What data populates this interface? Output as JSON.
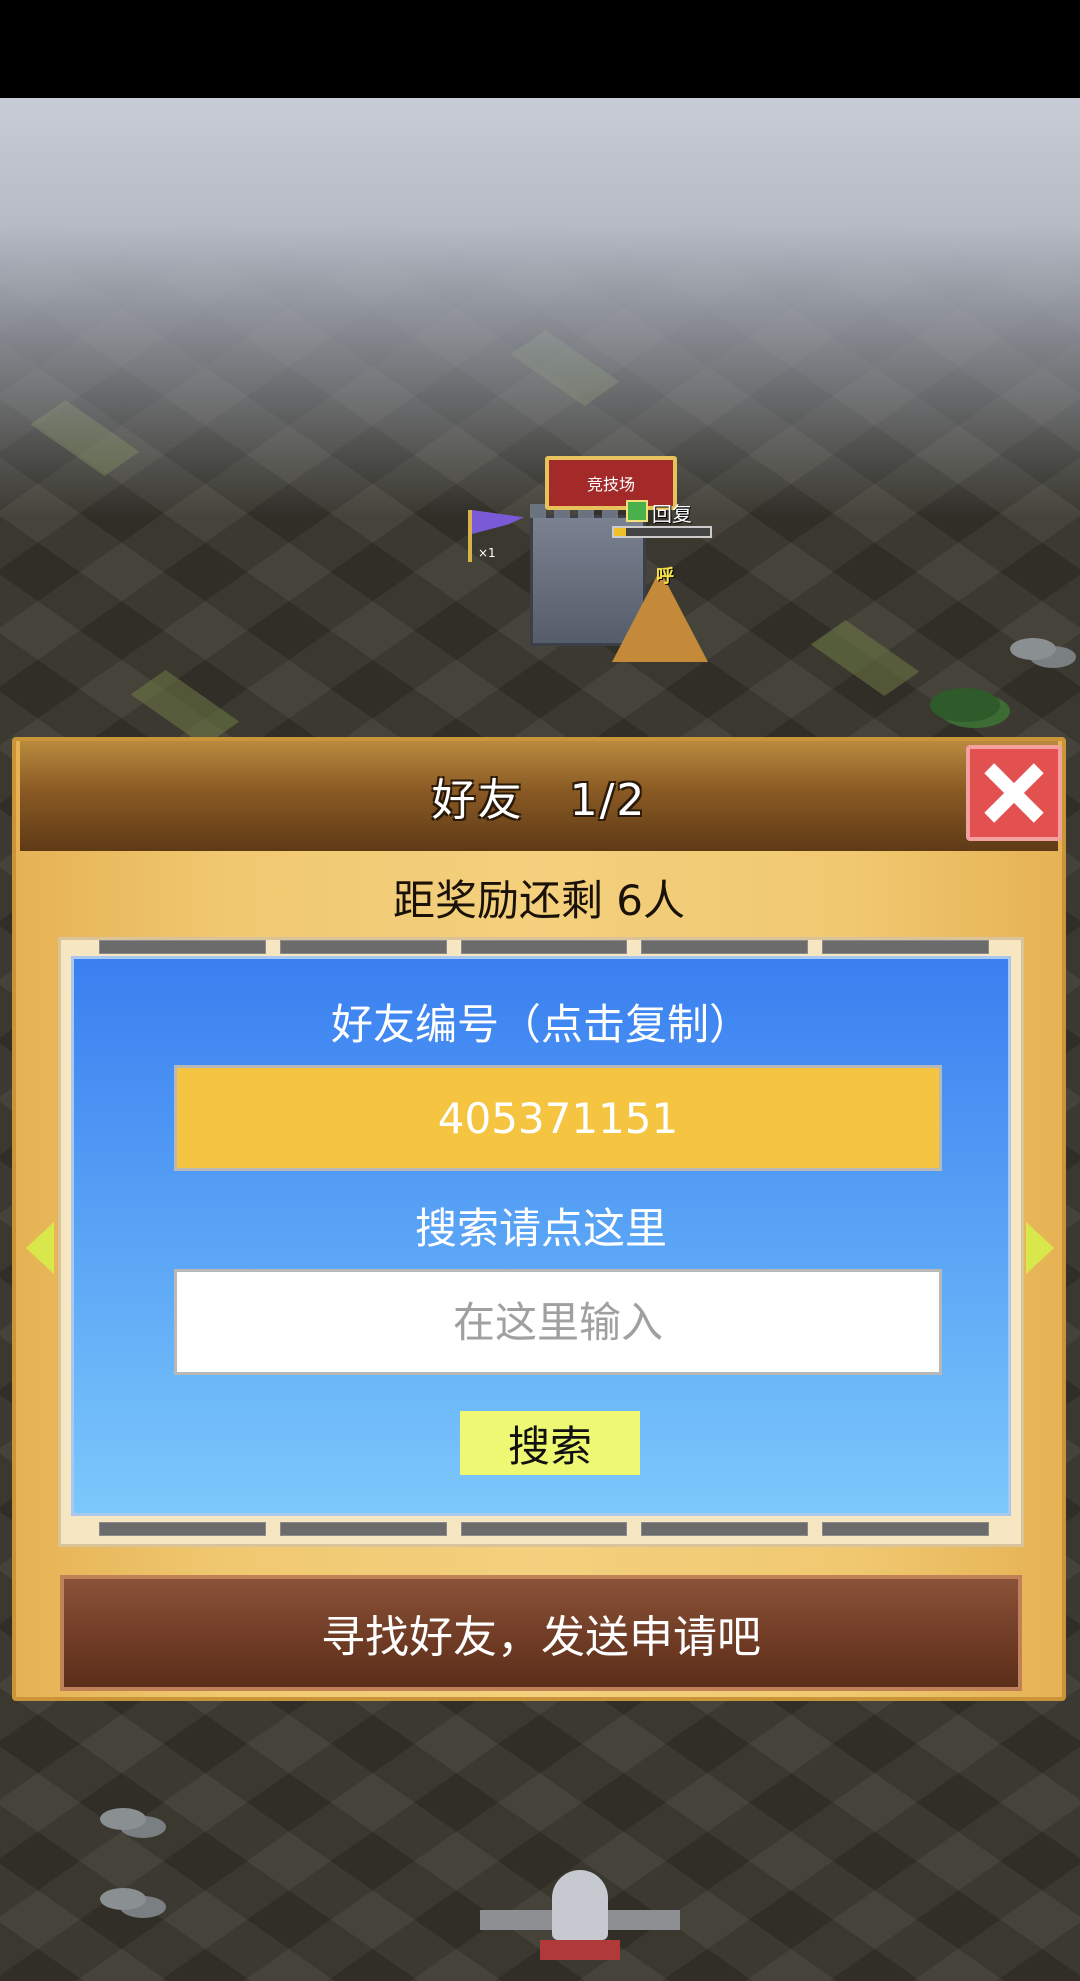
{
  "map": {
    "arena_label": "竞技场",
    "flag_count": "×1",
    "reply_label": "回复",
    "progress_fraction": 0.12,
    "shout_label": "呼"
  },
  "dialog": {
    "title": "好友　1/2",
    "reward_text": "距奖励还剩 6人",
    "friend_id_label": "好友编号（点击复制）",
    "friend_id": "405371151",
    "search_label": "搜索请点这里",
    "search_placeholder": "在这里输入",
    "search_button": "搜索",
    "find_friends_button": "寻找好友，发送申请吧"
  },
  "colors": {
    "accent_yellow": "#f5c542",
    "panel_blue": "#3a7ff0",
    "close_red": "#e25050",
    "button_brown": "#6e3a24"
  }
}
